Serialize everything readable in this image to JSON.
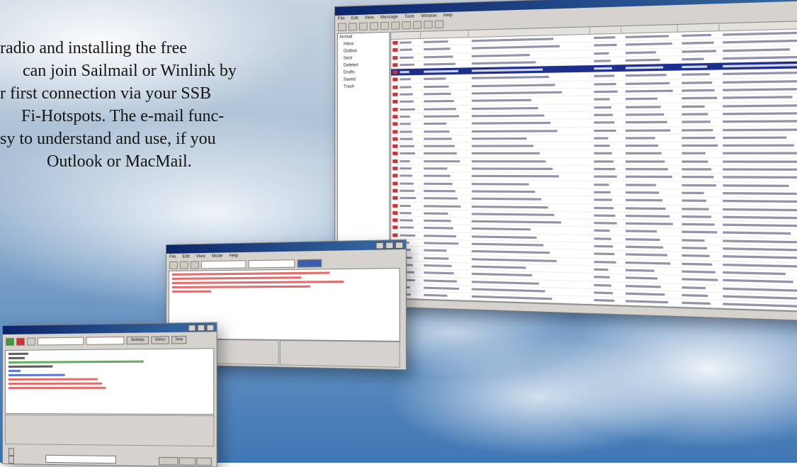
{
  "intro_text": {
    "line1": "radio and installing the free",
    "line2": "can join Sailmail or Winlink by",
    "line3": "r first connection via your SSB",
    "line4": "Fi-Hotspots. The e-mail func-",
    "line5": "sy to understand and use, if you",
    "line6": "Outlook or MacMail."
  },
  "mail_window": {
    "menu": [
      "File",
      "Edit",
      "View",
      "Message",
      "Tools",
      "Window",
      "Help"
    ],
    "folders": [
      "Airmail",
      "Inbox",
      "Outbox",
      "Sent",
      "Deleted",
      "Drafts",
      "Saved",
      "Trash"
    ]
  },
  "terminal_window": {
    "menu": [
      "File",
      "Edit",
      "View",
      "Mode",
      "Help"
    ]
  },
  "ssb_window": {
    "buttons": [
      "Settings",
      "Status",
      "Stop"
    ]
  },
  "colors": {
    "selection": "#1c2f8c",
    "terminal_text": "#d94848",
    "titlebar": "#0a246a"
  }
}
